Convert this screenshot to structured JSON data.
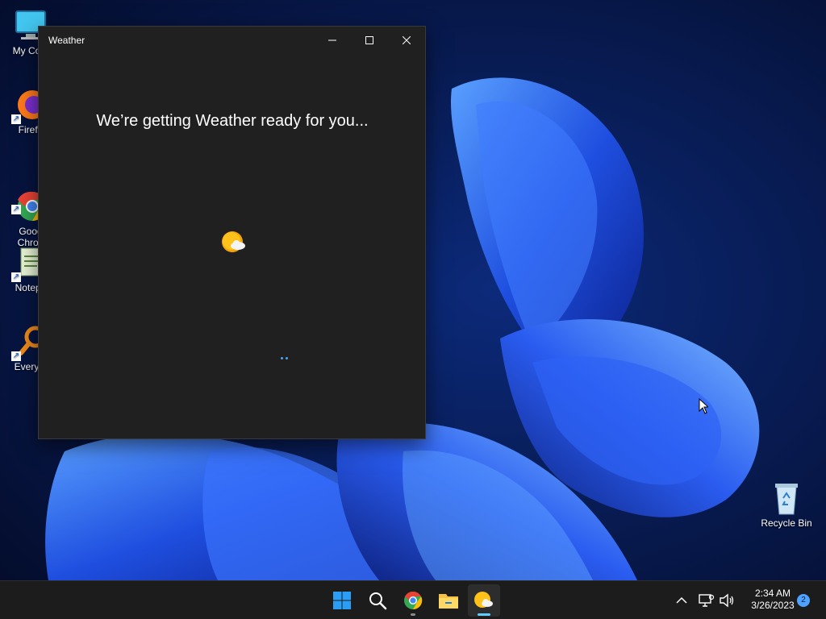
{
  "desktop": {
    "icons": [
      {
        "label": "My Com",
        "icon": "computer-icon"
      },
      {
        "label": "Firefo",
        "icon": "firefox-icon"
      },
      {
        "label": "Goog\nChron",
        "icon": "chrome-icon"
      },
      {
        "label": "Notepa",
        "icon": "notepad-icon"
      },
      {
        "label": "Everyth",
        "icon": "everything-search-icon"
      },
      {
        "label": "Recycle Bin",
        "icon": "recycle-bin-icon"
      }
    ]
  },
  "window": {
    "title": "Weather",
    "loading_message": "We’re getting Weather ready for you...",
    "controls": [
      "minimize",
      "maximize",
      "close"
    ]
  },
  "taskbar": {
    "apps": [
      {
        "name": "Start",
        "icon": "windows-start-icon"
      },
      {
        "name": "Search",
        "icon": "search-icon"
      },
      {
        "name": "Google Chrome",
        "icon": "chrome-icon"
      },
      {
        "name": "File Explorer",
        "icon": "folder-icon"
      },
      {
        "name": "Weather",
        "icon": "weather-icon",
        "active": true
      }
    ],
    "tray": {
      "icons": [
        "chevron-up-icon",
        "network-icon",
        "volume-icon"
      ],
      "time": "2:34 AM",
      "date": "3/26/2023",
      "notification_count": "2"
    }
  },
  "colors": {
    "window_bg": "#202020",
    "taskbar_bg": "#1c1c1c",
    "accent": "#60cdff",
    "wallpaper_bg": "#061235"
  }
}
